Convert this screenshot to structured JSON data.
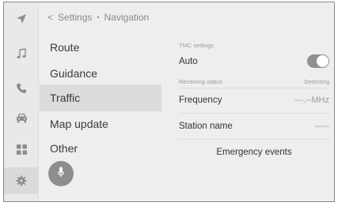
{
  "breadcrumb": {
    "back_glyph": "<",
    "parent": "Settings",
    "separator": "•",
    "current": "Navigation"
  },
  "rail": {
    "items": [
      {
        "icon": "navigation-arrow-icon"
      },
      {
        "icon": "music-note-icon"
      },
      {
        "icon": "phone-icon"
      },
      {
        "icon": "car-icon"
      },
      {
        "icon": "apps-grid-icon"
      },
      {
        "icon": "settings-gear-icon",
        "active": true
      }
    ]
  },
  "menu": {
    "items": [
      {
        "label": "Route"
      },
      {
        "label": "Guidance"
      },
      {
        "label": "Traffic",
        "selected": true
      },
      {
        "label": "Map update"
      },
      {
        "label": "Other"
      }
    ],
    "voice_button_icon": "microphone-icon"
  },
  "detail": {
    "tmc_settings_label": "TMC settings",
    "auto_label": "Auto",
    "auto_enabled": true,
    "receiving_status_label": "Receiving status",
    "receiving_status_value": "Detecting",
    "frequency_label": "Frequency",
    "frequency_value": "---.--MHz",
    "station_name_label": "Station name",
    "station_name_value": "-----",
    "emergency_events_label": "Emergency events"
  },
  "colors": {
    "background": "#eeeeee",
    "selected_row": "#dcdcdc",
    "toggle_on": "#8f8f8f",
    "icon": "#8c8c8c"
  }
}
